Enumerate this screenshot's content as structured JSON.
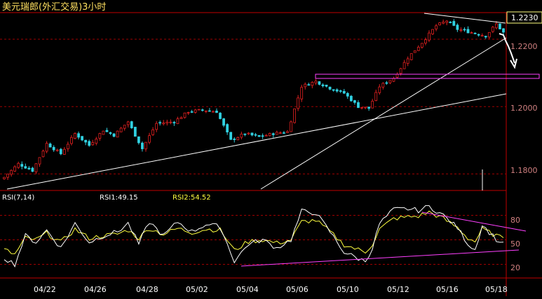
{
  "title": "美元瑞郎(外汇交易)3小时",
  "colors": {
    "background": "#000000",
    "frame": "#c00000",
    "grid": "#a00000",
    "up": "#e02020",
    "down": "#30d0e0",
    "trendline": "#ffffff",
    "channel": "#ff40ff",
    "rsi1": "#ffffff",
    "rsi2": "#ffff40",
    "tick_text": "#ffffff",
    "axis_text": "#d08080",
    "current_price_box": "#ffff80"
  },
  "chart_data": [
    {
      "type": "candlestick",
      "current_price": "1.2230",
      "y_ticks": [
        "1.2200",
        "1.2000",
        "1.1800"
      ],
      "ylim": [
        1.1755,
        1.2275
      ],
      "x_ticks": [
        "04/22",
        "04/26",
        "04/28",
        "05/02",
        "05/04",
        "05/06",
        "05/10",
        "05/12",
        "05/16",
        "05/18"
      ],
      "anchors": [
        {
          "i": 0,
          "v": 1.179
        },
        {
          "i": 4,
          "v": 1.183
        },
        {
          "i": 8,
          "v": 1.181
        },
        {
          "i": 12,
          "v": 1.189
        },
        {
          "i": 16,
          "v": 1.186
        },
        {
          "i": 20,
          "v": 1.192
        },
        {
          "i": 24,
          "v": 1.1885
        },
        {
          "i": 28,
          "v": 1.193
        },
        {
          "i": 31,
          "v": 1.1915
        },
        {
          "i": 35,
          "v": 1.1955
        },
        {
          "i": 39,
          "v": 1.1875
        },
        {
          "i": 43,
          "v": 1.195
        },
        {
          "i": 48,
          "v": 1.1955
        },
        {
          "i": 52,
          "v": 1.1985
        },
        {
          "i": 56,
          "v": 1.199
        },
        {
          "i": 60,
          "v": 1.1985
        },
        {
          "i": 64,
          "v": 1.19
        },
        {
          "i": 68,
          "v": 1.192
        },
        {
          "i": 72,
          "v": 1.191
        },
        {
          "i": 76,
          "v": 1.192
        },
        {
          "i": 80,
          "v": 1.1925
        },
        {
          "i": 84,
          "v": 1.206
        },
        {
          "i": 88,
          "v": 1.2075
        },
        {
          "i": 92,
          "v": 1.2055
        },
        {
          "i": 96,
          "v": 1.204
        },
        {
          "i": 100,
          "v": 1.2
        },
        {
          "i": 103,
          "v": 1.1995
        },
        {
          "i": 106,
          "v": 1.206
        },
        {
          "i": 110,
          "v": 1.2085
        },
        {
          "i": 114,
          "v": 1.2145
        },
        {
          "i": 118,
          "v": 1.219
        },
        {
          "i": 122,
          "v": 1.224
        },
        {
          "i": 125,
          "v": 1.2255
        },
        {
          "i": 128,
          "v": 1.223
        },
        {
          "i": 132,
          "v": 1.222
        },
        {
          "i": 136,
          "v": 1.221
        },
        {
          "i": 139,
          "v": 1.2245
        },
        {
          "i": 141,
          "v": 1.222
        }
      ]
    },
    {
      "type": "line",
      "label": "RSI(7,14)",
      "rsi1_label": "RSI1:49.15",
      "rsi2_label": "RSI2:54.52",
      "y_ticks": [
        "80",
        "50",
        "20"
      ],
      "ylim": [
        5,
        95
      ],
      "rsi1_anchors": [
        {
          "i": 0,
          "v": 28
        },
        {
          "i": 3,
          "v": 20
        },
        {
          "i": 6,
          "v": 55
        },
        {
          "i": 9,
          "v": 47
        },
        {
          "i": 12,
          "v": 62
        },
        {
          "i": 16,
          "v": 40
        },
        {
          "i": 20,
          "v": 70
        },
        {
          "i": 24,
          "v": 47
        },
        {
          "i": 28,
          "v": 55
        },
        {
          "i": 32,
          "v": 60
        },
        {
          "i": 35,
          "v": 70
        },
        {
          "i": 38,
          "v": 45
        },
        {
          "i": 41,
          "v": 72
        },
        {
          "i": 45,
          "v": 55
        },
        {
          "i": 49,
          "v": 72
        },
        {
          "i": 53,
          "v": 60
        },
        {
          "i": 57,
          "v": 69
        },
        {
          "i": 61,
          "v": 66
        },
        {
          "i": 65,
          "v": 24
        },
        {
          "i": 69,
          "v": 45
        },
        {
          "i": 73,
          "v": 50
        },
        {
          "i": 77,
          "v": 40
        },
        {
          "i": 81,
          "v": 50
        },
        {
          "i": 84,
          "v": 85
        },
        {
          "i": 88,
          "v": 83
        },
        {
          "i": 92,
          "v": 60
        },
        {
          "i": 96,
          "v": 35
        },
        {
          "i": 100,
          "v": 27
        },
        {
          "i": 102,
          "v": 24
        },
        {
          "i": 104,
          "v": 40
        },
        {
          "i": 106,
          "v": 70
        },
        {
          "i": 110,
          "v": 87
        },
        {
          "i": 114,
          "v": 88
        },
        {
          "i": 117,
          "v": 86
        },
        {
          "i": 120,
          "v": 91
        },
        {
          "i": 124,
          "v": 80
        },
        {
          "i": 128,
          "v": 65
        },
        {
          "i": 131,
          "v": 45
        },
        {
          "i": 133,
          "v": 38
        },
        {
          "i": 135,
          "v": 68
        },
        {
          "i": 138,
          "v": 55
        },
        {
          "i": 140,
          "v": 46
        },
        {
          "i": 141,
          "v": 49
        }
      ],
      "rsi2_anchors": [
        {
          "i": 0,
          "v": 38
        },
        {
          "i": 3,
          "v": 32
        },
        {
          "i": 6,
          "v": 52
        },
        {
          "i": 9,
          "v": 50
        },
        {
          "i": 12,
          "v": 58
        },
        {
          "i": 16,
          "v": 47
        },
        {
          "i": 20,
          "v": 63
        },
        {
          "i": 24,
          "v": 52
        },
        {
          "i": 28,
          "v": 55
        },
        {
          "i": 32,
          "v": 57
        },
        {
          "i": 35,
          "v": 62
        },
        {
          "i": 38,
          "v": 52
        },
        {
          "i": 41,
          "v": 64
        },
        {
          "i": 45,
          "v": 57
        },
        {
          "i": 49,
          "v": 64
        },
        {
          "i": 53,
          "v": 59
        },
        {
          "i": 57,
          "v": 63
        },
        {
          "i": 61,
          "v": 62
        },
        {
          "i": 65,
          "v": 37
        },
        {
          "i": 69,
          "v": 48
        },
        {
          "i": 73,
          "v": 50
        },
        {
          "i": 77,
          "v": 46
        },
        {
          "i": 81,
          "v": 50
        },
        {
          "i": 84,
          "v": 72
        },
        {
          "i": 88,
          "v": 74
        },
        {
          "i": 92,
          "v": 60
        },
        {
          "i": 96,
          "v": 44
        },
        {
          "i": 100,
          "v": 38
        },
        {
          "i": 102,
          "v": 35
        },
        {
          "i": 104,
          "v": 45
        },
        {
          "i": 106,
          "v": 63
        },
        {
          "i": 110,
          "v": 76
        },
        {
          "i": 114,
          "v": 78
        },
        {
          "i": 117,
          "v": 79
        },
        {
          "i": 120,
          "v": 84
        },
        {
          "i": 124,
          "v": 76
        },
        {
          "i": 128,
          "v": 65
        },
        {
          "i": 131,
          "v": 52
        },
        {
          "i": 133,
          "v": 48
        },
        {
          "i": 135,
          "v": 63
        },
        {
          "i": 138,
          "v": 57
        },
        {
          "i": 140,
          "v": 53
        },
        {
          "i": 141,
          "v": 54.5
        }
      ]
    }
  ]
}
